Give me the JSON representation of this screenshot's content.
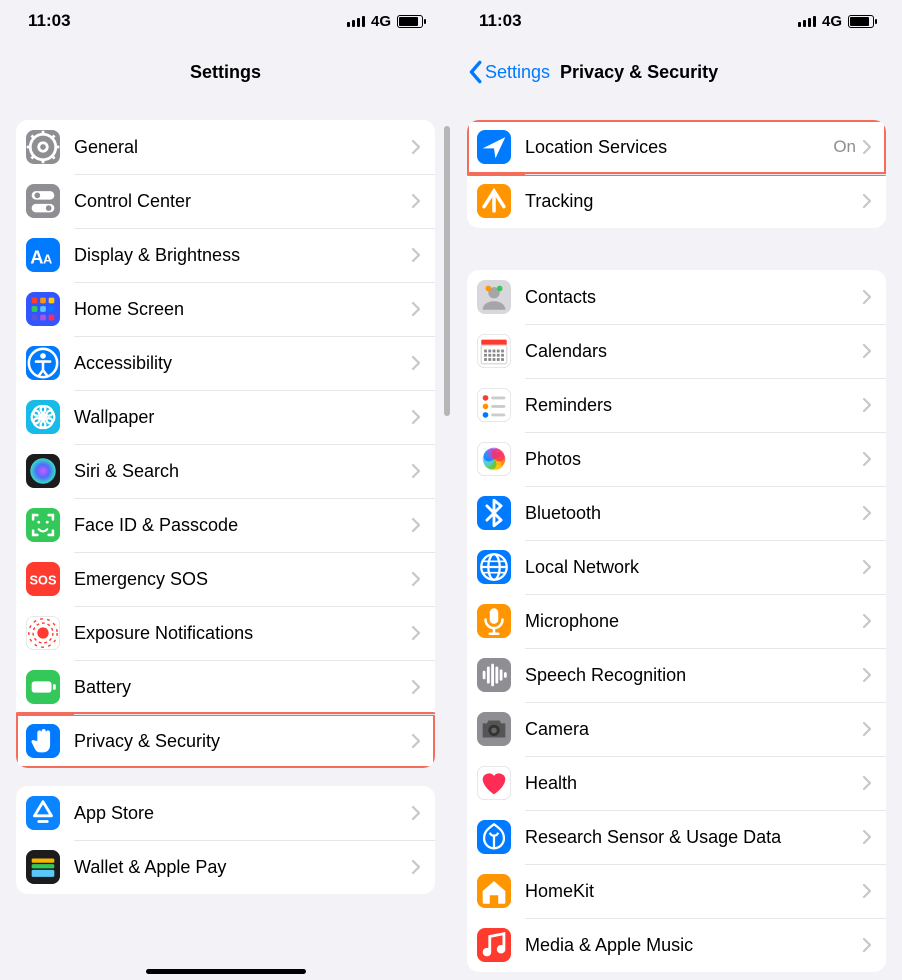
{
  "status": {
    "time": "11:03",
    "network": "4G"
  },
  "left": {
    "header_title": "Settings",
    "group1": [
      {
        "key": "general",
        "label": "General",
        "icon": "gear",
        "bg": "#8e8e93"
      },
      {
        "key": "control-center",
        "label": "Control Center",
        "icon": "switches",
        "bg": "#8e8e93"
      },
      {
        "key": "display-brightness",
        "label": "Display & Brightness",
        "icon": "aa",
        "bg": "#007aff"
      },
      {
        "key": "home-screen",
        "label": "Home Screen",
        "icon": "apps",
        "bg": "#3355ff"
      },
      {
        "key": "accessibility",
        "label": "Accessibility",
        "icon": "figure",
        "bg": "#007aff"
      },
      {
        "key": "wallpaper",
        "label": "Wallpaper",
        "icon": "flower",
        "bg": "#18bbe8"
      },
      {
        "key": "siri-search",
        "label": "Siri & Search",
        "icon": "siri",
        "bg": "#1c1c1e"
      },
      {
        "key": "faceid-passcode",
        "label": "Face ID & Passcode",
        "icon": "face",
        "bg": "#34c759"
      },
      {
        "key": "emergency-sos",
        "label": "Emergency SOS",
        "icon": "sos",
        "bg": "#ff3b30"
      },
      {
        "key": "exposure-notif",
        "label": "Exposure Notifications",
        "icon": "exposure",
        "bg": "#ffffff"
      },
      {
        "key": "battery",
        "label": "Battery",
        "icon": "battery",
        "bg": "#34c759"
      },
      {
        "key": "privacy-security",
        "label": "Privacy & Security",
        "icon": "hand",
        "bg": "#007aff",
        "highlight": true
      }
    ],
    "group2": [
      {
        "key": "app-store",
        "label": "App Store",
        "icon": "appstore",
        "bg": "#0a84ff"
      },
      {
        "key": "wallet-apple-pay",
        "label": "Wallet & Apple Pay",
        "icon": "wallet",
        "bg": "#1c1c1e"
      }
    ]
  },
  "right": {
    "back_label": "Settings",
    "header_title": "Privacy & Security",
    "group1": [
      {
        "key": "location-services",
        "label": "Location Services",
        "value": "On",
        "icon": "location",
        "bg": "#007aff",
        "highlight": true
      },
      {
        "key": "tracking",
        "label": "Tracking",
        "icon": "tracking",
        "bg": "#ff9500"
      }
    ],
    "group2": [
      {
        "key": "contacts",
        "label": "Contacts",
        "icon": "contacts",
        "bg": "#d8d8dc"
      },
      {
        "key": "calendars",
        "label": "Calendars",
        "icon": "calendar",
        "bg": "#ffffff"
      },
      {
        "key": "reminders",
        "label": "Reminders",
        "icon": "reminders",
        "bg": "#ffffff"
      },
      {
        "key": "photos",
        "label": "Photos",
        "icon": "photos",
        "bg": "#ffffff"
      },
      {
        "key": "bluetooth",
        "label": "Bluetooth",
        "icon": "bluetooth",
        "bg": "#007aff"
      },
      {
        "key": "local-network",
        "label": "Local Network",
        "icon": "globe",
        "bg": "#007aff"
      },
      {
        "key": "microphone",
        "label": "Microphone",
        "icon": "mic",
        "bg": "#ff9500"
      },
      {
        "key": "speech-recog",
        "label": "Speech Recognition",
        "icon": "wave",
        "bg": "#8e8e93"
      },
      {
        "key": "camera",
        "label": "Camera",
        "icon": "camera",
        "bg": "#8e8e93"
      },
      {
        "key": "health",
        "label": "Health",
        "icon": "heart",
        "bg": "#ffffff"
      },
      {
        "key": "research",
        "label": "Research Sensor & Usage Data",
        "icon": "research",
        "bg": "#007aff"
      },
      {
        "key": "homekit",
        "label": "HomeKit",
        "icon": "home",
        "bg": "#ff9500"
      },
      {
        "key": "media-music",
        "label": "Media & Apple Music",
        "icon": "music",
        "bg": "#ff3b30"
      }
    ]
  }
}
